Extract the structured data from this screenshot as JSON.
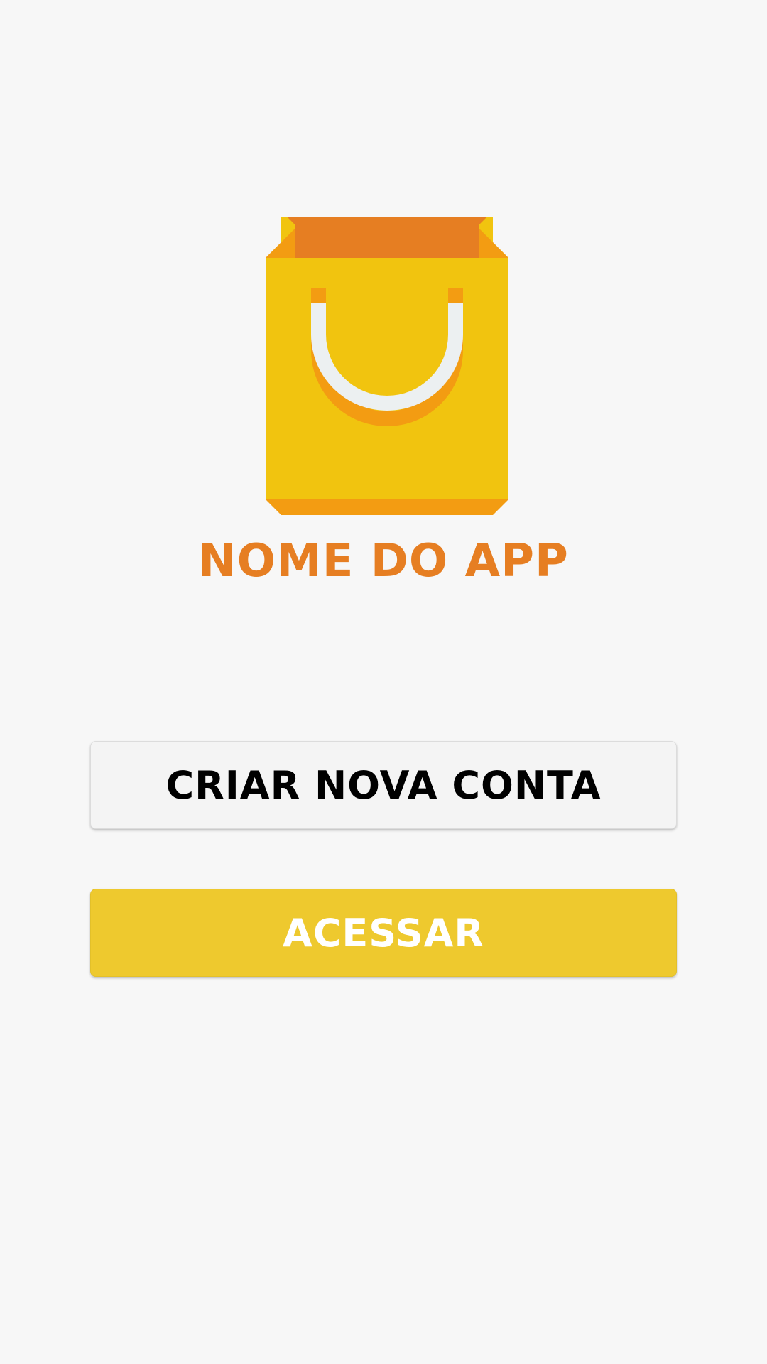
{
  "logo": {
    "icon": "shopping-bag-icon",
    "colors": {
      "bag": "#f1c40f",
      "top": "#e67e22",
      "accent": "#f39c12",
      "handle": "#ecf0f1"
    }
  },
  "app_name": "NOME DO APP",
  "buttons": {
    "create_account_label": "CRIAR NOVA CONTA",
    "access_label": "ACESSAR"
  },
  "colors": {
    "background": "#f7f7f7",
    "app_name": "#e67e22",
    "access_button": "#eec92e",
    "access_text": "#ffffff",
    "create_button": "#f4f4f4",
    "create_text": "#000000"
  }
}
